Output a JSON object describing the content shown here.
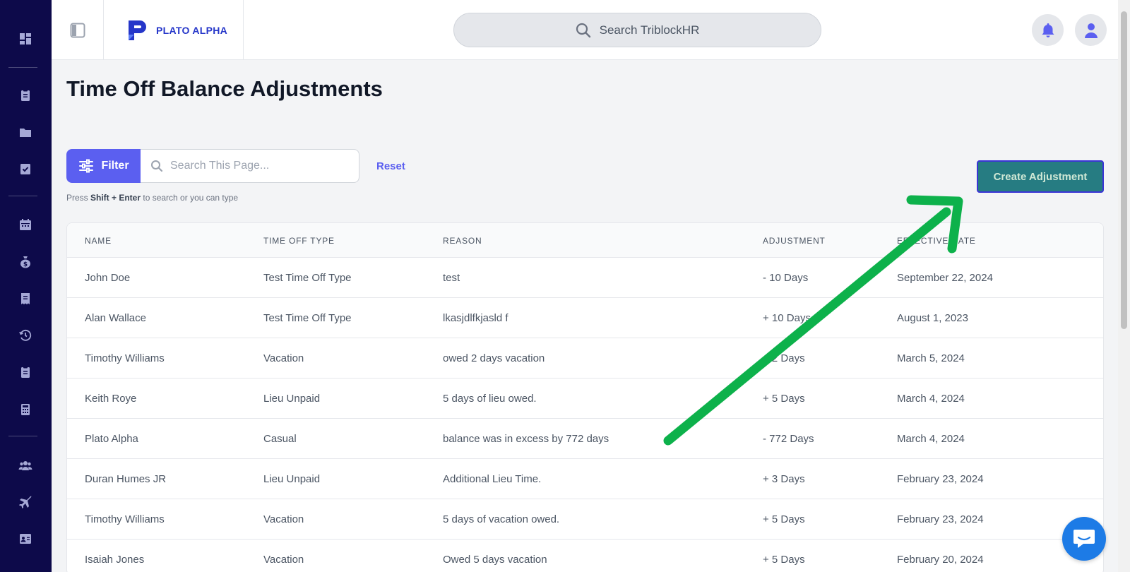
{
  "app": {
    "logo_text": "PLATO ALPHA",
    "search_placeholder": "Search TriblockHR",
    "brand_color": "#5b5ff0",
    "sidebar_color": "#0d0a4a"
  },
  "sidebar": {
    "items": [
      {
        "icon": "dashboard-icon"
      },
      {
        "icon": "clipboard-icon"
      },
      {
        "icon": "folder-icon"
      },
      {
        "icon": "checklist-icon"
      },
      {
        "icon": "calendar-icon"
      },
      {
        "icon": "money-bag-icon"
      },
      {
        "icon": "receipt-icon"
      },
      {
        "icon": "history-icon"
      },
      {
        "icon": "clipboard-list-icon"
      },
      {
        "icon": "calculator-icon"
      },
      {
        "icon": "users-icon"
      },
      {
        "icon": "plane-icon"
      },
      {
        "icon": "contact-card-icon"
      }
    ]
  },
  "page": {
    "title": "Time Off Balance Adjustments",
    "filter_label": "Filter",
    "search_placeholder": "Search This Page...",
    "reset_label": "Reset",
    "hint_prefix": "Press ",
    "hint_key": "Shift + Enter",
    "hint_suffix": " to search or you can type",
    "create_label": "Create Adjustment"
  },
  "table": {
    "columns": [
      "NAME",
      "TIME OFF TYPE",
      "REASON",
      "ADJUSTMENT",
      "EFFECTIVE DATE"
    ],
    "rows": [
      [
        "John Doe",
        "Test Time Off Type",
        "test",
        "- 10 Days",
        "September 22, 2024"
      ],
      [
        "Alan Wallace",
        "Test Time Off Type",
        "lkasjdlfkjasld f",
        "+ 10 Days",
        "August 1, 2023"
      ],
      [
        "Timothy Williams",
        "Vacation",
        "owed 2 days vacation",
        "+ 2 Days",
        "March 5, 2024"
      ],
      [
        "Keith Roye",
        "Lieu Unpaid",
        "5 days of lieu owed.",
        "+ 5 Days",
        "March 4, 2024"
      ],
      [
        "Plato Alpha",
        "Casual",
        "balance was in excess by 772 days",
        "- 772 Days",
        "March 4, 2024"
      ],
      [
        "Duran Humes JR",
        "Lieu Unpaid",
        "Additional Lieu Time.",
        "+ 3 Days",
        "February 23, 2024"
      ],
      [
        "Timothy Williams",
        "Vacation",
        "5 days of vacation owed.",
        "+ 5 Days",
        "February 23, 2024"
      ],
      [
        "Isaiah Jones",
        "Vacation",
        "Owed 5 days vacation",
        "+ 5 Days",
        "February 20, 2024"
      ]
    ]
  }
}
